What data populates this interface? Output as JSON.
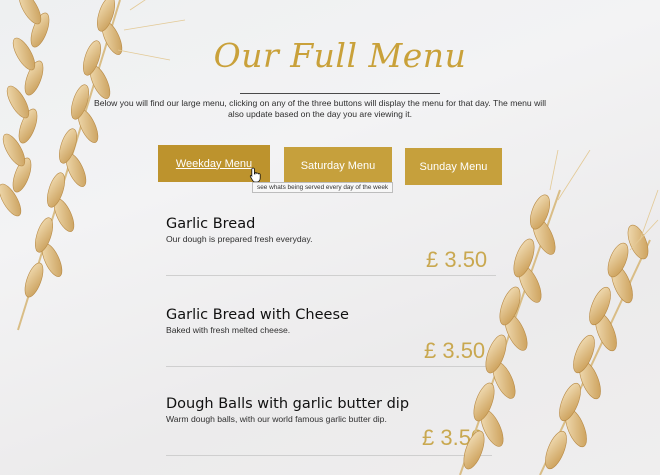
{
  "page": {
    "title": "Our Full Menu",
    "intro": "Below you will find our large menu, clicking on any of the three buttons will display the menu for that day. The menu will also update based on the day you are viewing it."
  },
  "buttons": {
    "weekday": "Weekday Menu",
    "saturday": "Saturday Menu",
    "sunday": "Sunday Menu",
    "tooltip": "see whats being served every day of the week"
  },
  "items": [
    {
      "name": "Garlic Bread",
      "description": "Our dough is prepared fresh everyday.",
      "price": "£ 3.50"
    },
    {
      "name": "Garlic Bread with Cheese",
      "description": "Baked with fresh melted cheese.",
      "price": "£ 3.50"
    },
    {
      "name": "Dough Balls with garlic butter dip",
      "description": "Warm dough balls, with our world famous garlic butter dip.",
      "price": "£ 3.50"
    }
  ],
  "colors": {
    "accent": "#c6a03c",
    "price": "#c9a850"
  },
  "icons": [
    "pointer-cursor-icon",
    "wheat-decoration"
  ]
}
